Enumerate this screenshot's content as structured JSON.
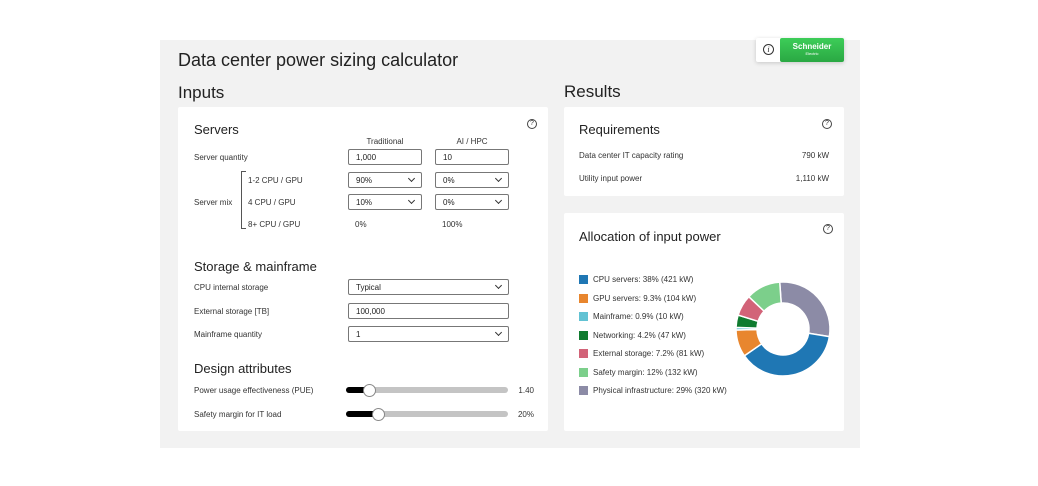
{
  "app": {
    "title": "Data center power sizing calculator"
  },
  "brand": {
    "name": "Schneider",
    "tagline": "Electric",
    "info_icon": "info-icon",
    "color": "#3dcd58"
  },
  "inputs": {
    "heading": "Inputs",
    "servers": {
      "title": "Servers",
      "col_traditional": "Traditional",
      "col_ai": "AI / HPC",
      "quantity_label": "Server quantity",
      "quantity_traditional": "1,000",
      "quantity_ai": "10",
      "mix_label": "Server mix",
      "mix_rows": [
        {
          "label": "1-2 CPU / GPU",
          "traditional": "90%",
          "ai": "0%"
        },
        {
          "label": "4 CPU / GPU",
          "traditional": "10%",
          "ai": "0%"
        },
        {
          "label": "8+ CPU / GPU",
          "traditional": "0%",
          "ai": "100%"
        }
      ]
    },
    "storage": {
      "title": "Storage & mainframe",
      "cpu_storage_label": "CPU internal storage",
      "cpu_storage_value": "Typical",
      "external_label": "External storage [TB]",
      "external_value": "100,000",
      "mainframe_label": "Mainframe quantity",
      "mainframe_value": "1"
    },
    "design": {
      "title": "Design attributes",
      "pue_label": "Power usage effectiveness (PUE)",
      "pue_value": "1.40",
      "pue_level": 0.14,
      "safety_label": "Safety margin for IT load",
      "safety_value": "20%",
      "safety_level": 0.2
    }
  },
  "results": {
    "heading": "Results",
    "requirements": {
      "title": "Requirements",
      "it_label": "Data center IT capacity rating",
      "it_value": "790 kW",
      "utility_label": "Utility input power",
      "utility_value": "1,110 kW"
    },
    "allocation": {
      "title": "Allocation of input power",
      "items": [
        {
          "label": "CPU servers: 38% (421 kW)",
          "value": 421,
          "color": "#1f77b4"
        },
        {
          "label": "GPU servers: 9.3% (104 kW)",
          "value": 104,
          "color": "#e8862e"
        },
        {
          "label": "Mainframe: 0.9% (10 kW)",
          "value": 10,
          "color": "#62c2d3"
        },
        {
          "label": "Networking: 4.2% (47 kW)",
          "value": 47,
          "color": "#0f7b2f"
        },
        {
          "label": "External storage: 7.2% (81 kW)",
          "value": 81,
          "color": "#d26378"
        },
        {
          "label": "Safety margin: 12% (132 kW)",
          "value": 132,
          "color": "#7ccf8b"
        },
        {
          "label": "Physical infrastructure: 29% (320 kW)",
          "value": 320,
          "color": "#8c8ba6"
        }
      ]
    }
  },
  "icons": {
    "help": "help-icon",
    "chevron": "chevron-down-icon"
  }
}
